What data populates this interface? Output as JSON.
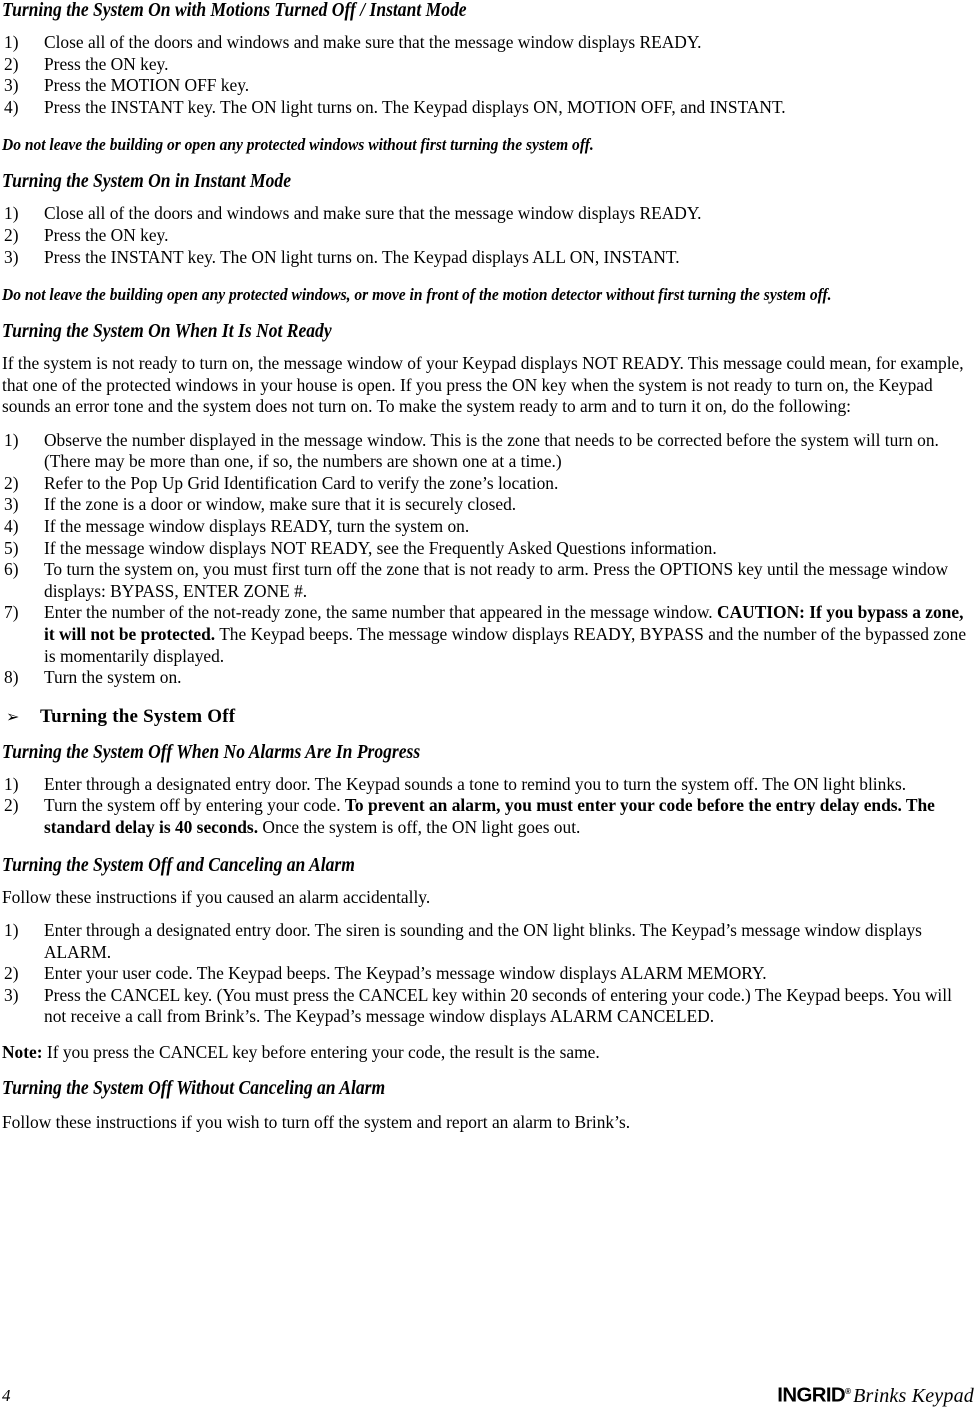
{
  "document": {
    "page_number": "4",
    "footer_brand": "INGRID",
    "footer_trademark": "®",
    "footer_product": "Brinks Keypad"
  },
  "sections": [
    {
      "id": "motions-off-instant",
      "heading": "Turning the System On with Motions Turned Off / Instant Mode",
      "steps": [
        {
          "num": "1)",
          "text": "Close all of the doors and windows and make sure that the message window displays READY."
        },
        {
          "num": "2)",
          "text": "Press the ON key."
        },
        {
          "num": "3)",
          "text": "Press the MOTION OFF key."
        },
        {
          "num": "4)",
          "text": "Press the INSTANT key. The ON light turns on. The Keypad displays ON, MOTION OFF, and INSTANT."
        }
      ],
      "warning": "Do not leave the building or open any protected windows without first turning the system off."
    },
    {
      "id": "instant-mode",
      "heading": "Turning the System On in Instant Mode",
      "steps": [
        {
          "num": "1)",
          "text": "Close all of the doors and windows and make sure that the message window displays READY."
        },
        {
          "num": "2)",
          "text": "Press the ON key."
        },
        {
          "num": "3)",
          "text": "Press the INSTANT key. The ON light turns on. The Keypad displays ALL ON, INSTANT."
        }
      ],
      "warning": "Do not leave the building open any protected windows, or move in front of the motion detector without first turning the system off."
    },
    {
      "id": "not-ready",
      "heading": "Turning the System On When It Is Not Ready",
      "intro": "If the system is not ready to turn on, the message window of your Keypad displays NOT READY. This message could mean, for example, that one of the protected windows in your house is open. If you press the ON key when the system is not ready to turn on, the Keypad sounds an error tone and the system does not turn on. To make the system ready to arm and to turn it on, do the following:",
      "steps": [
        {
          "num": "1)",
          "text": "Observe the number displayed in the message window. This is the zone that needs to be corrected before the system will turn on. (There may be more than one, if so, the numbers are shown one at a time.)"
        },
        {
          "num": "2)",
          "text": "Refer to the Pop Up Grid Identification Card to verify the zone’s location."
        },
        {
          "num": "3)",
          "text": "If the zone is a door or window, make sure that it is securely closed."
        },
        {
          "num": "4)",
          "text": "If the message window displays READY, turn the system on."
        },
        {
          "num": "5)",
          "text": "If the message window displays NOT READY, see the Frequently Asked Questions information."
        },
        {
          "num": "6)",
          "text": "To turn the system on, you must first turn off the zone that is not ready to arm. Press the OPTIONS key until the message window displays: BYPASS, ENTER ZONE #."
        },
        {
          "num": "7)",
          "parts": [
            {
              "text": "Enter the number of the not-ready zone, the same number that appeared in the message window. ",
              "bold": false
            },
            {
              "text": "CAUTION: If you bypass a zone, it will not be protected.",
              "bold": true
            },
            {
              "text": " The Keypad beeps. The message window displays READY, BYPASS and the number of the bypassed zone is momentarily displayed.",
              "bold": false
            }
          ]
        },
        {
          "num": "8)",
          "text": "Turn the system on."
        }
      ]
    }
  ],
  "turning_off": {
    "bullet_glyph": "➢",
    "heading": "Turning the System Off",
    "subsections": [
      {
        "id": "no-alarms",
        "heading": "Turning the System Off When No Alarms Are In Progress",
        "steps": [
          {
            "num": "1)",
            "text": "Enter through a designated entry door. The Keypad sounds a tone to remind you to turn the system off. The ON light blinks."
          },
          {
            "num": "2)",
            "parts": [
              {
                "text": "Turn the system off by entering your code. ",
                "bold": false
              },
              {
                "text": "To prevent an alarm, you must enter your code before the entry delay ends. The standard delay is 40 seconds.",
                "bold": true
              },
              {
                "text": " Once the system is off, the ON light goes out.",
                "bold": false
              }
            ]
          }
        ]
      },
      {
        "id": "canceling-alarm",
        "heading": "Turning the System Off and Canceling an Alarm",
        "intro": "Follow these instructions if you caused an alarm accidentally.",
        "steps": [
          {
            "num": "1)",
            "text": "Enter through a designated entry door. The siren is sounding and the ON light blinks. The Keypad’s message window displays ALARM."
          },
          {
            "num": "2)",
            "text": "Enter your user code. The Keypad beeps. The Keypad’s message window displays ALARM MEMORY."
          },
          {
            "num": "3)",
            "text": "Press the CANCEL key. (You must press the CANCEL key within 20 seconds of entering your code.) The Keypad beeps. You will not receive a call from Brink’s. The Keypad’s message window displays ALARM CANCELED."
          }
        ],
        "note_label": "Note:",
        "note_text": " If you press the CANCEL key before entering your code, the result is the same."
      },
      {
        "id": "without-canceling",
        "heading": "Turning the System Off Without Canceling an Alarm",
        "intro": "Follow these instructions if you wish to turn off the system and report an alarm to Brink’s."
      }
    ]
  }
}
